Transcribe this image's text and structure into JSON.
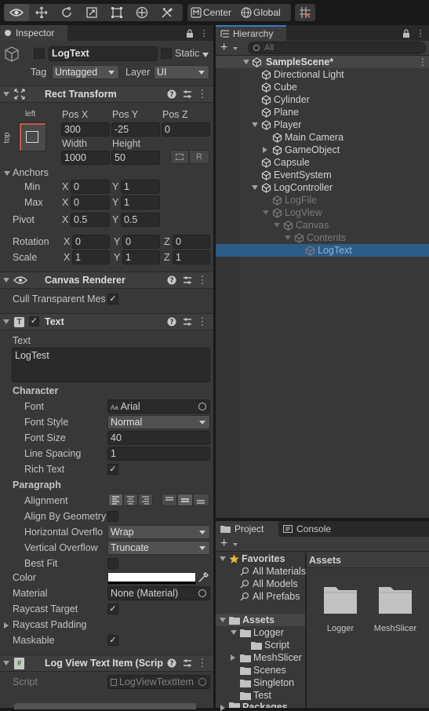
{
  "toolbar": {
    "center_label": "Center",
    "global_label": "Global"
  },
  "inspector": {
    "tab_label": "Inspector",
    "object_name": "LogText",
    "static_label": "Static",
    "tag_label": "Tag",
    "tag_value": "Untagged",
    "layer_label": "Layer",
    "layer_value": "UI",
    "rect_transform": {
      "title": "Rect Transform",
      "anchor_h": "left",
      "anchor_v": "top",
      "posx_label": "Pos X",
      "posy_label": "Pos Y",
      "posz_label": "Pos Z",
      "posx": "300",
      "posy": "-25",
      "posz": "0",
      "width_label": "Width",
      "height_label": "Height",
      "width": "1000",
      "height": "50",
      "r_label": "R",
      "anchors_label": "Anchors",
      "min_label": "Min",
      "max_label": "Max",
      "x_label": "X",
      "y_label": "Y",
      "z_label": "Z",
      "min_x": "0",
      "min_y": "1",
      "max_x": "0",
      "max_y": "1",
      "pivot_label": "Pivot",
      "pivot_x": "0.5",
      "pivot_y": "0.5",
      "rotation_label": "Rotation",
      "rot_x": "0",
      "rot_y": "0",
      "rot_z": "0",
      "scale_label": "Scale",
      "scale_x": "1",
      "scale_y": "1",
      "scale_z": "1"
    },
    "canvas_renderer": {
      "title": "Canvas Renderer",
      "cull_label": "Cull Transparent Mes"
    },
    "text": {
      "title": "Text",
      "text_label": "Text",
      "text_value": "LogTest",
      "character_label": "Character",
      "font_label": "Font",
      "font_value": "Arial",
      "font_prefix": "Aa",
      "font_style_label": "Font Style",
      "font_style_value": "Normal",
      "font_size_label": "Font Size",
      "font_size_value": "40",
      "line_spacing_label": "Line Spacing",
      "line_spacing_value": "1",
      "rich_text_label": "Rich Text",
      "paragraph_label": "Paragraph",
      "alignment_label": "Alignment",
      "align_geom_label": "Align By Geometry",
      "h_overflow_label": "Horizontal Overflo",
      "h_overflow_value": "Wrap",
      "v_overflow_label": "Vertical Overflow",
      "v_overflow_value": "Truncate",
      "best_fit_label": "Best Fit",
      "color_label": "Color",
      "material_label": "Material",
      "material_value": "None (Material)",
      "raycast_target_label": "Raycast Target",
      "raycast_padding_label": "Raycast Padding",
      "maskable_label": "Maskable"
    },
    "script_comp": {
      "title": "Log View Text Item (Scrip",
      "script_label": "Script",
      "script_value": "LogViewTextItem"
    }
  },
  "hierarchy": {
    "tab_label": "Hierarchy",
    "search_placeholder": "All",
    "scene_name": "SampleScene*",
    "items": [
      {
        "label": "Directional Light"
      },
      {
        "label": "Cube"
      },
      {
        "label": "Cylinder"
      },
      {
        "label": "Plane"
      },
      {
        "label": "Player"
      },
      {
        "label": "Main Camera"
      },
      {
        "label": "GameObject"
      },
      {
        "label": "Capsule"
      },
      {
        "label": "EventSystem"
      },
      {
        "label": "LogController"
      },
      {
        "label": "LogFile"
      },
      {
        "label": "LogView"
      },
      {
        "label": "Canvas"
      },
      {
        "label": "Contents"
      },
      {
        "label": "LogText"
      }
    ]
  },
  "project": {
    "tab_project": "Project",
    "tab_console": "Console",
    "favorites_label": "Favorites",
    "favorites": [
      "All Materials",
      "All Models",
      "All Prefabs"
    ],
    "assets_label": "Assets",
    "tree": [
      "Logger",
      "Script",
      "MeshSlicer",
      "Scenes",
      "Singleton",
      "Test"
    ],
    "packages_label": "Packages",
    "grid_header": "Assets",
    "folders": [
      "Logger",
      "MeshSlicer"
    ]
  }
}
